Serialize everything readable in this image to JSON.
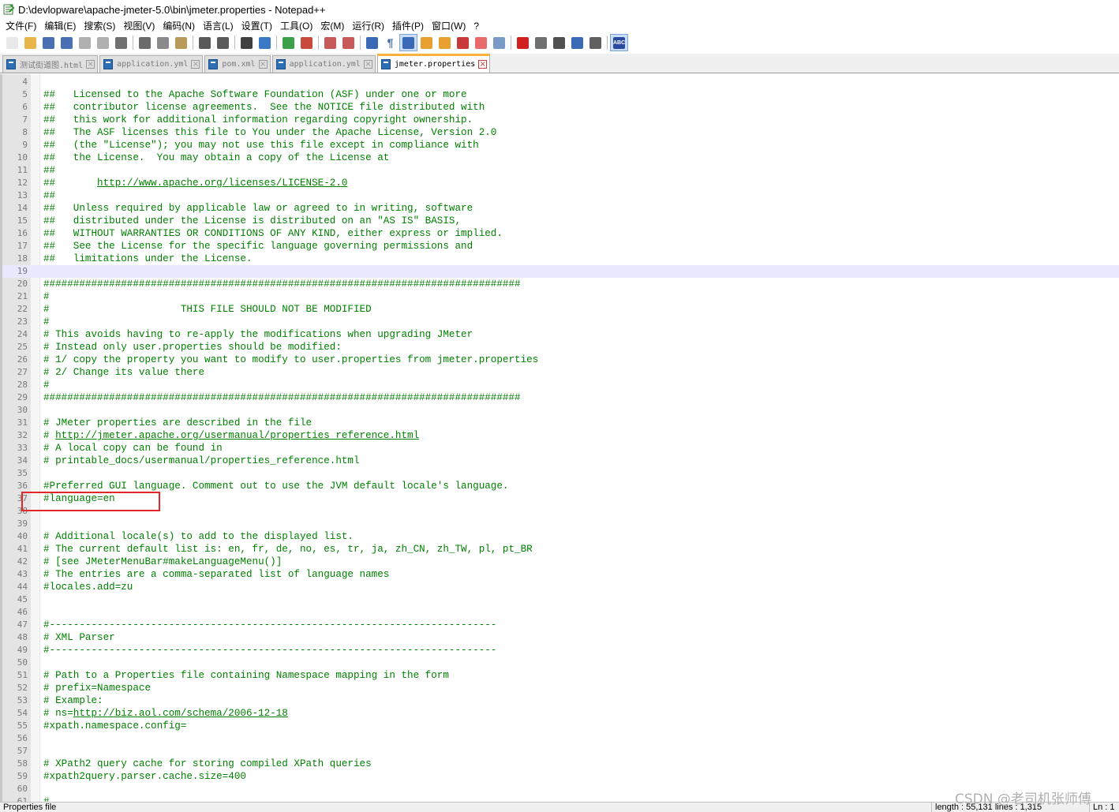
{
  "window": {
    "title": "D:\\devlopware\\apache-jmeter-5.0\\bin\\jmeter.properties - Notepad++"
  },
  "menu": [
    "文件(F)",
    "编辑(E)",
    "搜索(S)",
    "视图(V)",
    "编码(N)",
    "语言(L)",
    "设置(T)",
    "工具(O)",
    "宏(M)",
    "运行(R)",
    "插件(P)",
    "窗口(W)",
    "?"
  ],
  "toolbar": {
    "buttons": [
      {
        "icon": "new-file-icon",
        "color": "#e8e8e8"
      },
      {
        "icon": "open-folder-icon",
        "color": "#e7b54a"
      },
      {
        "icon": "save-icon",
        "color": "#4a6fb3"
      },
      {
        "icon": "save-all-icon",
        "color": "#4a6fb3"
      },
      {
        "icon": "close-file-icon",
        "color": "#b0b0b0"
      },
      {
        "icon": "close-all-icon",
        "color": "#b0b0b0"
      },
      {
        "icon": "print-icon",
        "color": "#707070"
      },
      {
        "sep": true
      },
      {
        "icon": "cut-icon",
        "color": "#6a6a6a"
      },
      {
        "icon": "copy-icon",
        "color": "#8a8a8a"
      },
      {
        "icon": "paste-icon",
        "color": "#b89a5a"
      },
      {
        "sep": true
      },
      {
        "icon": "undo-icon",
        "color": "#5a5a5a"
      },
      {
        "icon": "redo-icon",
        "color": "#5a5a5a"
      },
      {
        "sep": true
      },
      {
        "icon": "find-icon",
        "color": "#404040"
      },
      {
        "icon": "replace-icon",
        "color": "#3a78c8"
      },
      {
        "sep": true
      },
      {
        "icon": "zoom-in-icon",
        "color": "#3aa04a"
      },
      {
        "icon": "zoom-out-icon",
        "color": "#c84a3a"
      },
      {
        "sep": true
      },
      {
        "icon": "sync-vertical-icon",
        "color": "#c85a5a"
      },
      {
        "icon": "sync-horizontal-icon",
        "color": "#c85a5a"
      },
      {
        "sep": true
      },
      {
        "icon": "word-wrap-icon",
        "color": "#3a6ab5"
      },
      {
        "icon": "show-all-chars-icon",
        "color": "#3a6ab5",
        "glyph": "¶"
      },
      {
        "icon": "indent-guide-icon",
        "color": "#3a6ab5",
        "active": true
      },
      {
        "icon": "language-icon",
        "color": "#e8a030"
      },
      {
        "icon": "doc-map-icon",
        "color": "#e8a030"
      },
      {
        "icon": "function-list-icon",
        "color": "#c83a3a"
      },
      {
        "icon": "folder-workspace-icon",
        "color": "#e86a6a"
      },
      {
        "icon": "monitoring-icon",
        "color": "#7a9ac8"
      },
      {
        "sep": true
      },
      {
        "icon": "record-macro-icon",
        "color": "#d02020"
      },
      {
        "icon": "stop-macro-icon",
        "color": "#707070"
      },
      {
        "icon": "play-macro-icon",
        "color": "#505050"
      },
      {
        "icon": "run-macro-multiple-icon",
        "color": "#3a6ab5"
      },
      {
        "icon": "save-macro-icon",
        "color": "#606060"
      },
      {
        "sep": true
      },
      {
        "icon": "spell-check-icon",
        "color": "#2a4aa0",
        "glyph": "ABC",
        "active": true
      }
    ]
  },
  "tabs": [
    {
      "label": "测试街道图.html",
      "active": false
    },
    {
      "label": "application.yml",
      "active": false
    },
    {
      "label": "pom.xml",
      "active": false
    },
    {
      "label": "application.yml",
      "active": false
    },
    {
      "label": "jmeter.properties",
      "active": true
    }
  ],
  "editor": {
    "current_line": "19",
    "lines": [
      {
        "n": "4",
        "t": ""
      },
      {
        "n": "5",
        "t": "##   Licensed to the Apache Software Foundation (ASF) under one or more"
      },
      {
        "n": "6",
        "t": "##   contributor license agreements.  See the NOTICE file distributed with"
      },
      {
        "n": "7",
        "t": "##   this work for additional information regarding copyright ownership."
      },
      {
        "n": "8",
        "t": "##   The ASF licenses this file to You under the Apache License, Version 2.0"
      },
      {
        "n": "9",
        "t": "##   (the \"License\"); you may not use this file except in compliance with"
      },
      {
        "n": "10",
        "t": "##   the License.  You may obtain a copy of the License at"
      },
      {
        "n": "11",
        "t": "##"
      },
      {
        "n": "12",
        "t": "##       ",
        "u": "http://www.apache.org/licenses/LICENSE-2.0"
      },
      {
        "n": "13",
        "t": "##"
      },
      {
        "n": "14",
        "t": "##   Unless required by applicable law or agreed to in writing, software"
      },
      {
        "n": "15",
        "t": "##   distributed under the License is distributed on an \"AS IS\" BASIS,"
      },
      {
        "n": "16",
        "t": "##   WITHOUT WARRANTIES OR CONDITIONS OF ANY KIND, either express or implied."
      },
      {
        "n": "17",
        "t": "##   See the License for the specific language governing permissions and"
      },
      {
        "n": "18",
        "t": "##   limitations under the License."
      },
      {
        "n": "19",
        "t": ""
      },
      {
        "n": "20",
        "t": "################################################################################"
      },
      {
        "n": "21",
        "t": "#"
      },
      {
        "n": "22",
        "t": "#                      THIS FILE SHOULD NOT BE MODIFIED"
      },
      {
        "n": "23",
        "t": "#"
      },
      {
        "n": "24",
        "t": "# This avoids having to re-apply the modifications when upgrading JMeter"
      },
      {
        "n": "25",
        "t": "# Instead only user.properties should be modified:"
      },
      {
        "n": "26",
        "t": "# 1/ copy the property you want to modify to user.properties from jmeter.properties"
      },
      {
        "n": "27",
        "t": "# 2/ Change its value there"
      },
      {
        "n": "28",
        "t": "#"
      },
      {
        "n": "29",
        "t": "################################################################################"
      },
      {
        "n": "30",
        "t": ""
      },
      {
        "n": "31",
        "t": "# JMeter properties are described in the file"
      },
      {
        "n": "32",
        "t": "# ",
        "u": "http://jmeter.apache.org/usermanual/properties_reference.html"
      },
      {
        "n": "33",
        "t": "# A local copy can be found in"
      },
      {
        "n": "34",
        "t": "# printable_docs/usermanual/properties_reference.html"
      },
      {
        "n": "35",
        "t": ""
      },
      {
        "n": "36",
        "t": "#Preferred GUI language. Comment out to use the JVM default locale's language."
      },
      {
        "n": "37",
        "t": "#language=en"
      },
      {
        "n": "38",
        "t": ""
      },
      {
        "n": "39",
        "t": ""
      },
      {
        "n": "40",
        "t": "# Additional locale(s) to add to the displayed list."
      },
      {
        "n": "41",
        "t": "# The current default list is: en, fr, de, no, es, tr, ja, zh_CN, zh_TW, pl, pt_BR"
      },
      {
        "n": "42",
        "t": "# [see JMeterMenuBar#makeLanguageMenu()]"
      },
      {
        "n": "43",
        "t": "# The entries are a comma-separated list of language names"
      },
      {
        "n": "44",
        "t": "#locales.add=zu"
      },
      {
        "n": "45",
        "t": ""
      },
      {
        "n": "46",
        "t": ""
      },
      {
        "n": "47",
        "t": "#---------------------------------------------------------------------------"
      },
      {
        "n": "48",
        "t": "# XML Parser"
      },
      {
        "n": "49",
        "t": "#---------------------------------------------------------------------------"
      },
      {
        "n": "50",
        "t": ""
      },
      {
        "n": "51",
        "t": "# Path to a Properties file containing Namespace mapping in the form"
      },
      {
        "n": "52",
        "t": "# prefix=Namespace"
      },
      {
        "n": "53",
        "t": "# Example:"
      },
      {
        "n": "54",
        "t": "# ns=",
        "u": "http://biz.aol.com/schema/2006-12-18"
      },
      {
        "n": "55",
        "t": "#xpath.namespace.config="
      },
      {
        "n": "56",
        "t": ""
      },
      {
        "n": "57",
        "t": ""
      },
      {
        "n": "58",
        "t": "# XPath2 query cache for storing compiled XPath queries"
      },
      {
        "n": "59",
        "t": "#xpath2query.parser.cache.size=400"
      },
      {
        "n": "60",
        "t": ""
      },
      {
        "n": "61",
        "t": "#"
      }
    ]
  },
  "status": {
    "file_type": "Properties file",
    "length": "length : 55,131    lines : 1,315",
    "position": "Ln : 1"
  },
  "watermark": "CSDN @老司机张师傅"
}
